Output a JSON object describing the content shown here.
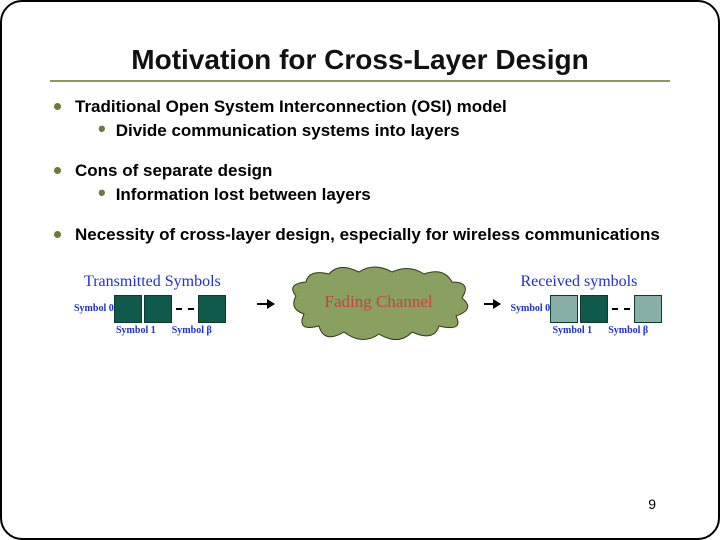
{
  "title": "Motivation for Cross-Layer Design",
  "bullets": [
    {
      "text": "Traditional Open System Interconnection (OSI) model",
      "subs": [
        "Divide communication systems into layers"
      ]
    },
    {
      "text": "Cons of separate design",
      "subs": [
        "Information lost between layers"
      ]
    },
    {
      "text": "Necessity of cross-layer design, especially for wireless communications",
      "subs": []
    }
  ],
  "figure": {
    "left_label": "Transmitted Symbols",
    "right_label": "Received symbols",
    "sym0": "Symbol 0",
    "sym1": "Symbol 1",
    "symb": "Symbol β",
    "cloud": "Fading Channel"
  },
  "page": "9"
}
